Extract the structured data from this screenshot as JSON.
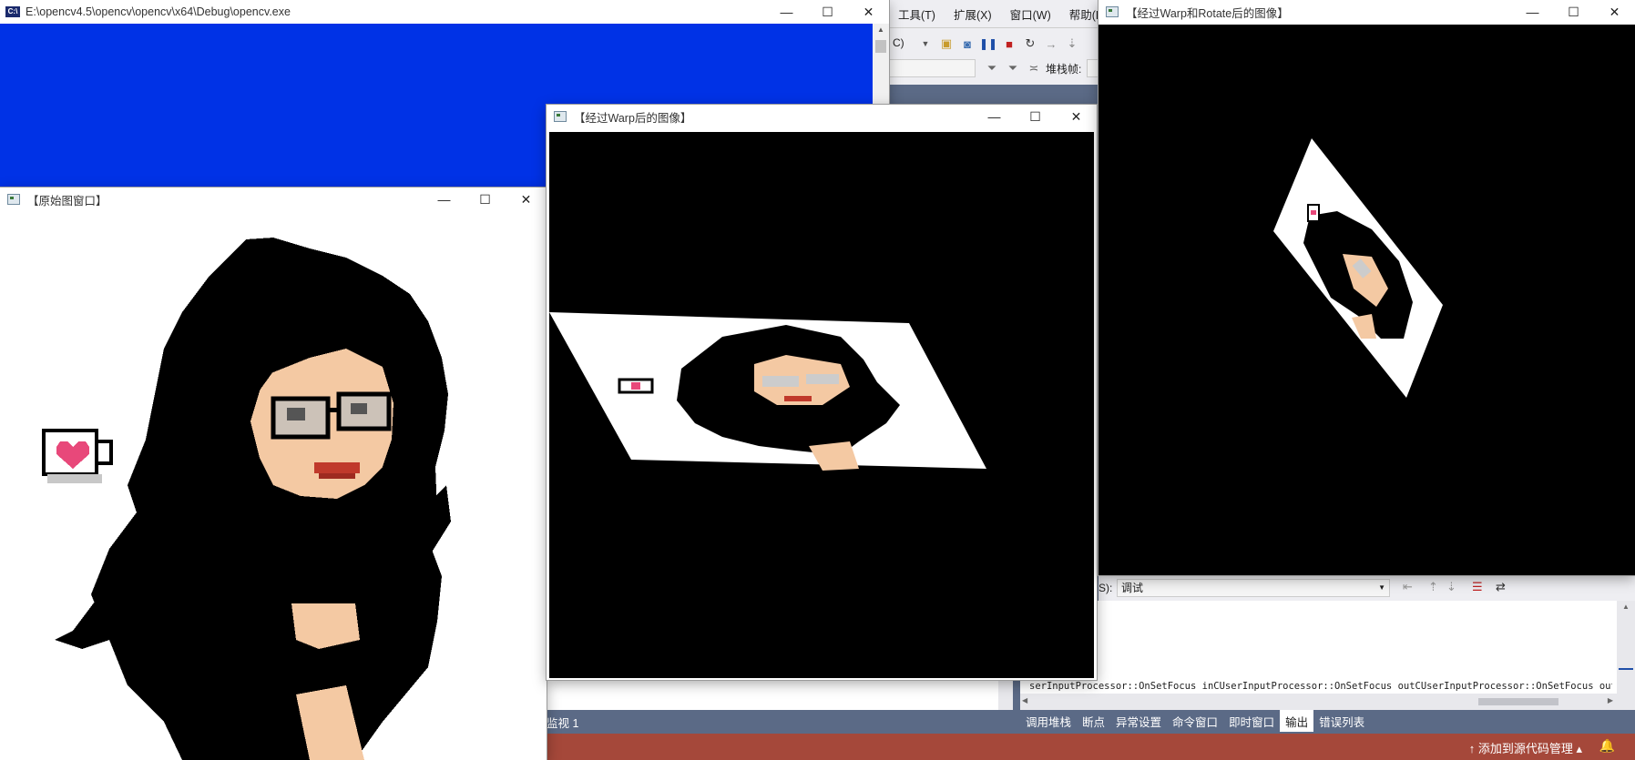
{
  "console_window": {
    "title": "E:\\opencv4.5\\opencv\\opencv\\x64\\Debug\\opencv.exe",
    "icon": "cv-app-icon",
    "bg_color": "#0032e6"
  },
  "vs": {
    "menu": [
      "工具(T)",
      "扩展(X)",
      "窗口(W)",
      "帮助(H"
    ],
    "toolbar_fragment": "C)",
    "stack_frame_label": "堆栈帧:",
    "output_source_label": "S):",
    "output_source_value": "调试",
    "output_text": "serInputProcessor::OnSetFocus inCUserInputProcessor::OnSetFocus outCUserInputProcessor::OnSetFocus out",
    "watch_tab": "监视 1",
    "bottom_tabs": [
      "调用堆栈",
      "断点",
      "异常设置",
      "命令窗口",
      "即时窗口",
      "输出",
      "错误列表"
    ],
    "active_tab": "输出",
    "status_source_control": "添加到源代码管理",
    "status_color": "#a5483a"
  },
  "windows": {
    "original": {
      "title": "【原始图窗口】"
    },
    "warp": {
      "title": "【经过Warp后的图像】"
    },
    "warp_rotate": {
      "title": "【经过Warp和Rotate后的图像】"
    }
  },
  "controls": {
    "minimize": "—",
    "maximize": "☐",
    "close": "✕"
  }
}
